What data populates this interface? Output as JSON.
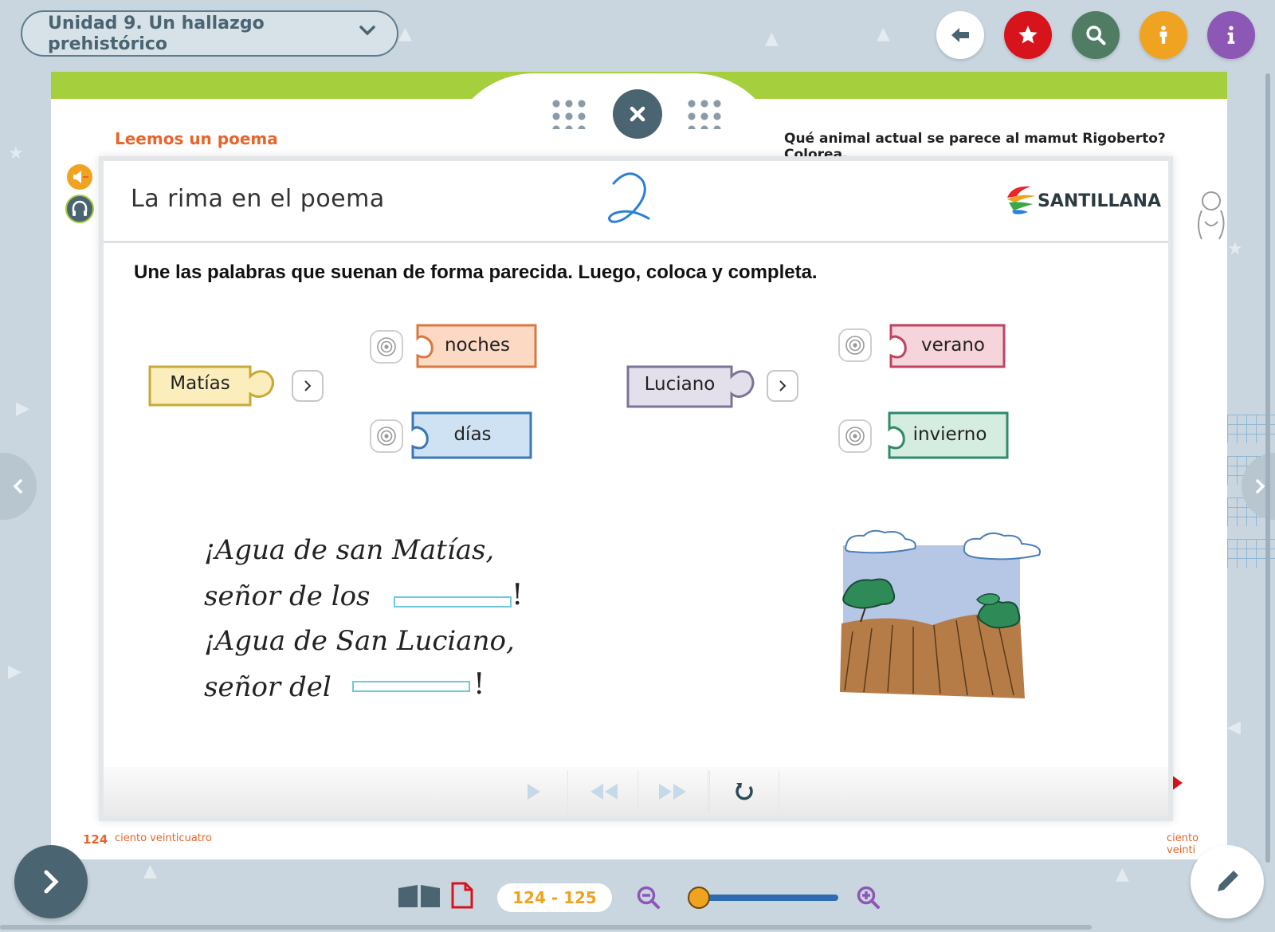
{
  "header": {
    "unit_title": "Unidad 9. Un hallazgo prehistórico",
    "buttons": [
      {
        "icon": "back-arrow-icon",
        "color": "#ffffff"
      },
      {
        "icon": "star-icon",
        "color": "#d7141c"
      },
      {
        "icon": "search-icon",
        "color": "#4f7c63"
      },
      {
        "icon": "accessibility-icon",
        "color": "#f0a320"
      },
      {
        "icon": "info-icon",
        "color": "#8d57b5"
      }
    ]
  },
  "book": {
    "left_heading": "Leemos un poema",
    "right_heading": "Qué animal actual se parece al mamut Rigoberto? Colorea.",
    "left_page_number": "124",
    "left_page_words": "ciento veinticuatro",
    "right_page_words": "ciento veinti"
  },
  "modal": {
    "title": "La rima en el poema",
    "logo_text": "SANTILLANA",
    "instruction": "Une las palabras que suenan de forma parecida. Luego, coloca y completa.",
    "group1": {
      "source": "Matías",
      "options": [
        "noches",
        "días"
      ]
    },
    "group2": {
      "source": "Luciano",
      "options": [
        "verano",
        "invierno"
      ]
    },
    "poem": {
      "line1": "¡Agua de san Matías,",
      "line2": "señor de los",
      "line3": "¡Agua de San Luciano,",
      "line4": "señor del",
      "excl": "!"
    }
  },
  "footer": {
    "page_range": "124 - 125",
    "zoom_fraction": 0.06
  },
  "colors": {
    "accent": "#4b6472",
    "green_band": "#a5cf3c",
    "heading_orange": "#e8642a",
    "page_pill_text": "#f0a320"
  }
}
